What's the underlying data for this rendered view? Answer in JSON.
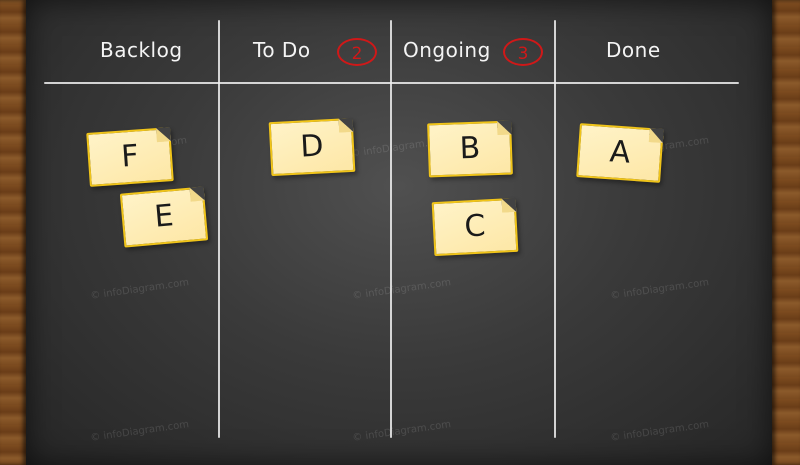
{
  "columns": [
    {
      "title": "Backlog",
      "wip_limit": null
    },
    {
      "title": "To Do",
      "wip_limit": "2"
    },
    {
      "title": "Ongoing",
      "wip_limit": "3"
    },
    {
      "title": "Done",
      "wip_limit": null
    }
  ],
  "notes": [
    {
      "label": "F",
      "column": "Backlog"
    },
    {
      "label": "E",
      "column": "Backlog"
    },
    {
      "label": "D",
      "column": "To Do"
    },
    {
      "label": "B",
      "column": "Ongoing"
    },
    {
      "label": "C",
      "column": "Ongoing"
    },
    {
      "label": "A",
      "column": "Done"
    }
  ],
  "watermark": "© infoDiagram.com",
  "colors": {
    "chalk": "#f4f4f4",
    "limit_circle": "#d01818",
    "note_fill": "#fde7a6",
    "note_border": "#f0c419",
    "board": "#3a3a3a",
    "frame": "#7a4a1f"
  }
}
